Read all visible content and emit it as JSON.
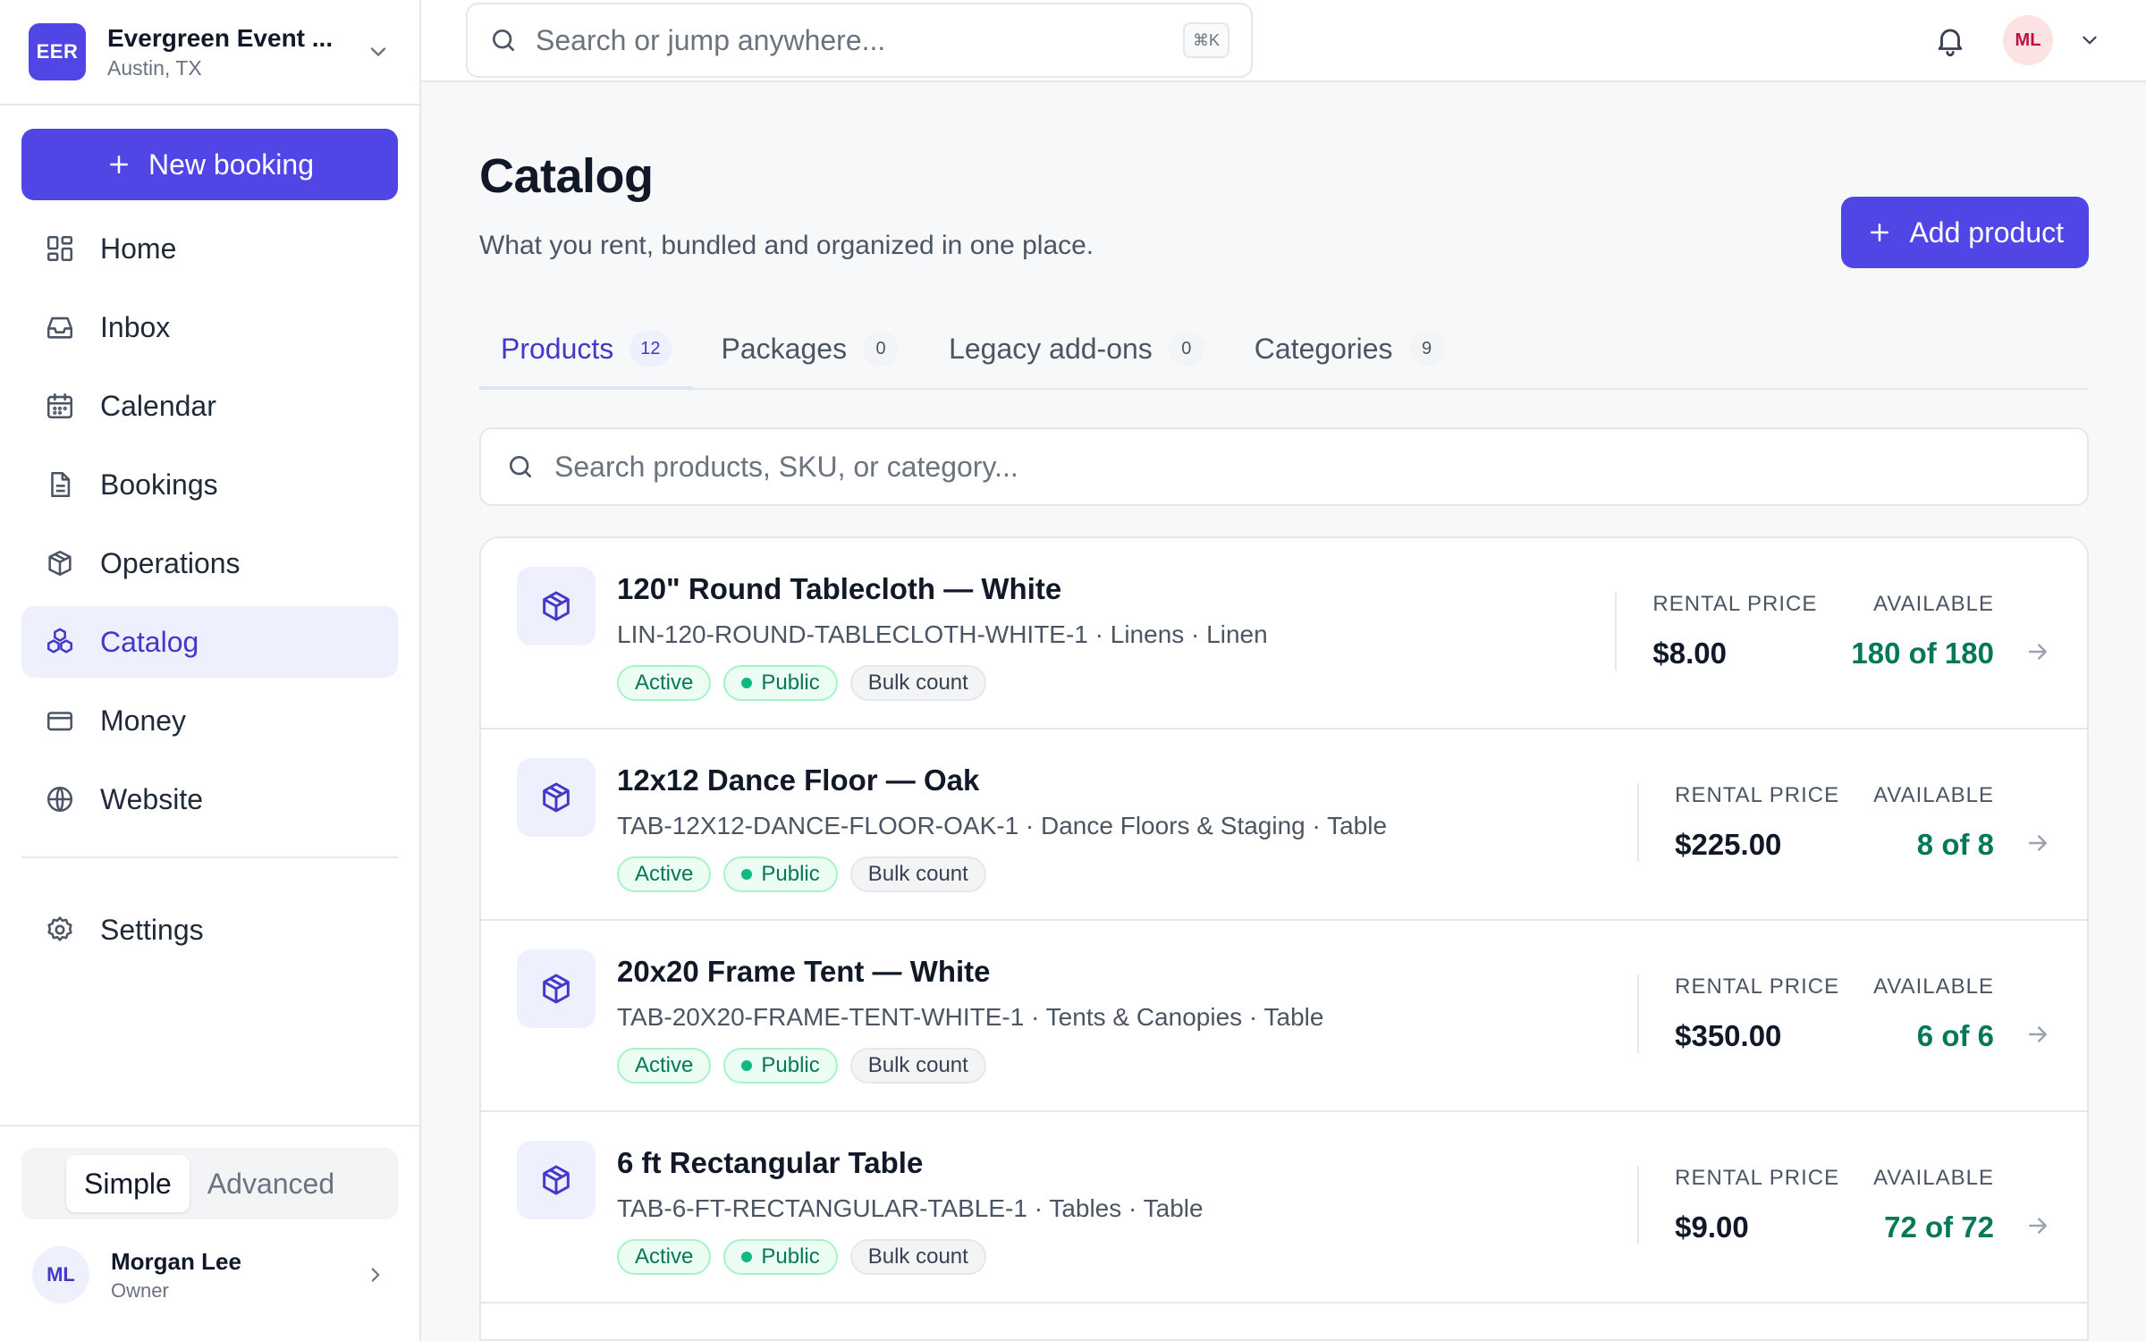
{
  "org": {
    "initials": "EER",
    "name": "Evergreen Event ...",
    "city": "Austin, TX"
  },
  "sidebar": {
    "new_booking_label": "New booking",
    "items": [
      {
        "label": "Home",
        "icon": "grid-icon"
      },
      {
        "label": "Inbox",
        "icon": "inbox-icon"
      },
      {
        "label": "Calendar",
        "icon": "calendar-icon"
      },
      {
        "label": "Bookings",
        "icon": "document-icon"
      },
      {
        "label": "Operations",
        "icon": "boxes-icon"
      },
      {
        "label": "Catalog",
        "icon": "cubes-icon"
      },
      {
        "label": "Money",
        "icon": "card-icon"
      },
      {
        "label": "Website",
        "icon": "globe-icon"
      }
    ],
    "settings_label": "Settings",
    "mode": {
      "simple": "Simple",
      "advanced": "Advanced",
      "selected": "Simple"
    },
    "user": {
      "initials": "ML",
      "name": "Morgan Lee",
      "role": "Owner"
    }
  },
  "topbar": {
    "search_placeholder": "Search or jump anywhere...",
    "shortcut": "⌘K",
    "avatar_initials": "ML"
  },
  "page": {
    "title": "Catalog",
    "subtitle": "What you rent, bundled and organized in one place.",
    "add_product_label": "Add product",
    "tabs": [
      {
        "label": "Products",
        "count": "12"
      },
      {
        "label": "Packages",
        "count": "0"
      },
      {
        "label": "Legacy add-ons",
        "count": "0"
      },
      {
        "label": "Categories",
        "count": "9"
      }
    ],
    "product_search_placeholder": "Search products, SKU, or category...",
    "stat_labels": {
      "price": "RENTAL PRICE",
      "available": "AVAILABLE"
    },
    "products": [
      {
        "name": "120\" Round Tablecloth — White",
        "meta": "LIN-120-ROUND-TABLECLOTH-WHITE-1 · Linens · Linen",
        "badges": [
          "Active",
          "Public",
          "Bulk count"
        ],
        "price": "$8.00",
        "available": "180 of 180"
      },
      {
        "name": "12x12 Dance Floor — Oak",
        "meta": "TAB-12X12-DANCE-FLOOR-OAK-1 · Dance Floors & Staging · Table",
        "badges": [
          "Active",
          "Public",
          "Bulk count"
        ],
        "price": "$225.00",
        "available": "8 of 8"
      },
      {
        "name": "20x20 Frame Tent — White",
        "meta": "TAB-20X20-FRAME-TENT-WHITE-1 · Tents & Canopies · Table",
        "badges": [
          "Active",
          "Public",
          "Bulk count"
        ],
        "price": "$350.00",
        "available": "6 of 6"
      },
      {
        "name": "6 ft Rectangular Table",
        "meta": "TAB-6-FT-RECTANGULAR-TABLE-1 · Tables · Table",
        "badges": [
          "Active",
          "Public",
          "Bulk count"
        ],
        "price": "$9.00",
        "available": "72 of 72"
      }
    ]
  },
  "colors": {
    "accent": "#4f46e5",
    "accent_soft": "#eef0fd",
    "success": "#047857"
  }
}
